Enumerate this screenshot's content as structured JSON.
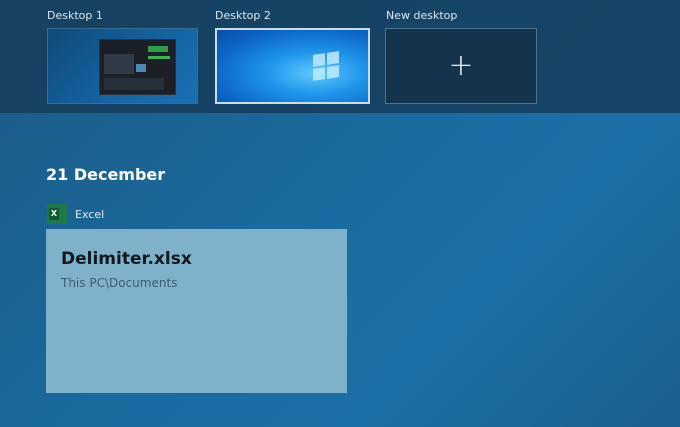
{
  "desktops": [
    {
      "label": "Desktop 1"
    },
    {
      "label": "Desktop 2"
    },
    {
      "label": "New desktop",
      "icon": "plus-icon",
      "glyph": "+"
    }
  ],
  "timeline": {
    "date": "21 December",
    "app": {
      "name": "Excel",
      "icon": "excel-icon",
      "icon_letter": "X",
      "color": "#1d7a44"
    },
    "card": {
      "title": "Delimiter.xlsx",
      "path": "This PC\\Documents"
    }
  },
  "colors": {
    "accent": "#1c6fa6",
    "card": "#7fb1cb",
    "selected_border": "#c9dceb"
  }
}
